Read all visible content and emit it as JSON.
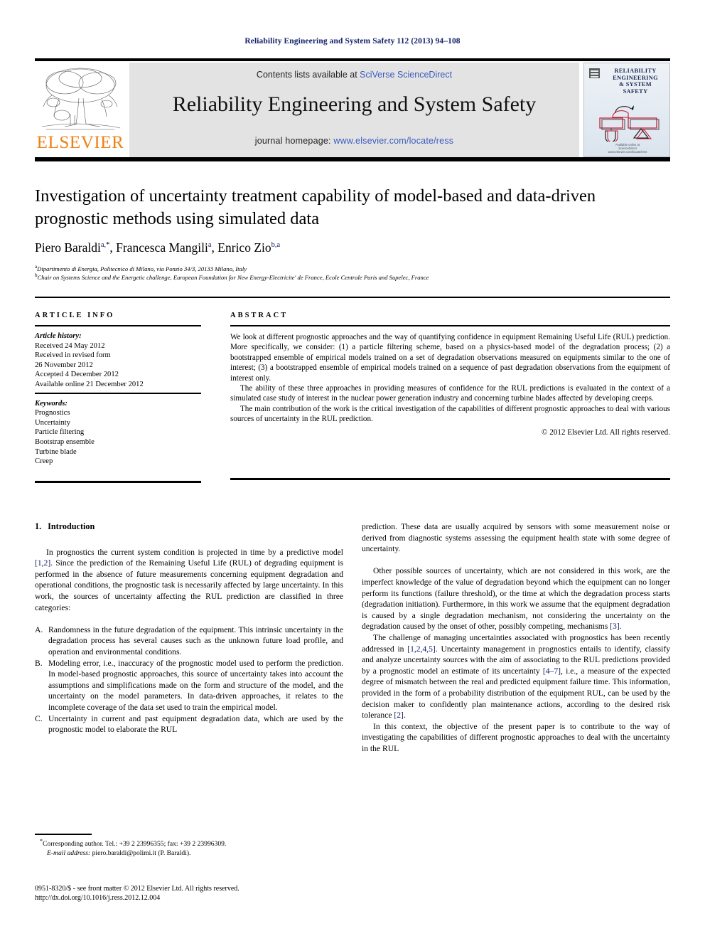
{
  "running_head": "Reliability Engineering and System Safety 112 (2013) 94–108",
  "masthead": {
    "contents_prefix": "Contents lists available at ",
    "contents_link": "SciVerse ScienceDirect",
    "journal_title": "Reliability Engineering and System Safety",
    "homepage_prefix": "journal homepage: ",
    "homepage_link": "www.elsevier.com/locate/ress",
    "publisher_wordmark": "ELSEVIER",
    "publisher_accent": "#f07f13"
  },
  "cover": {
    "title_lines": [
      "RELIABILITY",
      "ENGINEERING",
      "& SYSTEM",
      "SAFETY"
    ],
    "footer_line1": "Available online at",
    "footer_line2": "ScienceDirect",
    "footer_line3": "www.elsevier.com/locate/ress"
  },
  "article": {
    "title": "Investigation of uncertainty treatment capability of model-based and data-driven prognostic methods using simulated data",
    "authors": [
      {
        "name": "Piero Baraldi",
        "sup": "a,",
        "star": "*",
        "sep": ", "
      },
      {
        "name": "Francesca Mangili",
        "sup": "a",
        "star": "",
        "sep": ", "
      },
      {
        "name": "Enrico Zio",
        "sup": "b,a",
        "star": "",
        "sep": ""
      }
    ],
    "affiliations": [
      {
        "mark": "a",
        "text": "Dipartimento di Energia, Politecnico di Milano, via Ponzio 34/3, 20133 Milano, Italy"
      },
      {
        "mark": "b",
        "text": "Chair on Systems Science and the Energetic challenge, European Foundation for New Energy-Electricite' de France, Ecole Centrale Paris and Supelec, France"
      }
    ]
  },
  "article_info": {
    "heading": "ARTICLE INFO",
    "history_label": "Article history:",
    "history": [
      "Received 24 May 2012",
      "Received in revised form",
      "26 November 2012",
      "Accepted 4 December 2012",
      "Available online 21 December 2012"
    ],
    "keywords_label": "Keywords:",
    "keywords": [
      "Prognostics",
      "Uncertainty",
      "Particle filtering",
      "Bootstrap ensemble",
      "Turbine blade",
      "Creep"
    ]
  },
  "abstract": {
    "heading": "ABSTRACT",
    "paragraphs": [
      "We look at different prognostic approaches and the way of quantifying confidence in equipment Remaining Useful Life (RUL) prediction. More specifically, we consider: (1) a particle filtering scheme, based on a physics-based model of the degradation process; (2) a bootstrapped ensemble of empirical models trained on a set of degradation observations measured on equipments similar to the one of interest; (3) a bootstrapped ensemble of empirical models trained on a sequence of past degradation observations from the equipment of interest only.",
      "The ability of these three approaches in providing measures of confidence for the RUL predictions is evaluated in the context of a simulated case study of interest in the nuclear power generation industry and concerning turbine blades affected by developing creeps.",
      "The main contribution of the work is the critical investigation of the capabilities of different prognostic approaches to deal with various sources of uncertainty in the RUL prediction."
    ],
    "copyright": "© 2012 Elsevier Ltd. All rights reserved."
  },
  "body": {
    "section_number": "1.",
    "section_title": "Introduction",
    "left_paragraph_1_a": "In prognostics the current system condition is projected in time by a predictive model ",
    "left_ref_1": "[1,2]",
    "left_paragraph_1_b": ". Since the prediction of the Remaining Useful Life (RUL) of degrading equipment is performed in the absence of future measurements concerning equipment degradation and operational conditions, the prognostic task is necessarily affected by large uncertainty. In this work, the sources of uncertainty affecting the RUL prediction are classified in three categories:",
    "list_items": [
      {
        "marker": "A.",
        "text": "Randomness in the future degradation of the equipment. This intrinsic uncertainty in the degradation process has several causes such as the unknown future load profile, and operation and environmental conditions."
      },
      {
        "marker": "B.",
        "text": "Modeling error, i.e., inaccuracy of the prognostic model used to perform the prediction. In model-based prognostic approaches, this source of uncertainty takes into account the assumptions and simplifications made on the form and structure of the model, and the uncertainty on the model parameters. In data-driven approaches, it relates to the incomplete coverage of the data set used to train the empirical model."
      },
      {
        "marker": "C.",
        "text": "Uncertainty in current and past equipment degradation data, which are used by the prognostic model to elaborate the RUL"
      }
    ],
    "right_paragraph_1": "prediction. These data are usually acquired by sensors with some measurement noise or derived from diagnostic systems assessing the equipment health state with some degree of uncertainty.",
    "right_paragraph_2_a": "Other possible sources of uncertainty, which are not considered in this work, are the imperfect knowledge of the value of degradation beyond which the equipment can no longer perform its functions (failure threshold), or the time at which the degradation process starts (degradation initiation). Furthermore, in this work we assume that the equipment degradation is caused by a single degradation mechanism, not considering the uncertainty on the degradation caused by the onset of other, possibly competing, mechanisms ",
    "right_ref_2": "[3]",
    "right_paragraph_2_b": ".",
    "right_paragraph_3_a": "The challenge of managing uncertainties associated with prognostics has been recently addressed in ",
    "right_ref_3": "[1,2,4,5]",
    "right_paragraph_3_b": ". Uncertainty management in prognostics entails to identify, classify and analyze uncertainty sources with the aim of associating to the RUL predictions provided by a prognostic model an estimate of its uncertainty ",
    "right_ref_4": "[4–7]",
    "right_paragraph_3_c": ", i.e., a measure of the expected degree of mismatch between the real and predicted equipment failure time. This information, provided in the form of a probability distribution of the equipment RUL, can be used by the decision maker to confidently plan maintenance actions, according to the desired risk tolerance ",
    "right_ref_5": "[2]",
    "right_paragraph_3_d": ".",
    "right_paragraph_4": "In this context, the objective of the present paper is to contribute to the way of investigating the capabilities of different prognostic approaches to deal with the uncertainty in the RUL"
  },
  "footnotes": {
    "corresponding": "Corresponding author. Tel.: +39 2 23996355; fax: +39 2 23996309.",
    "email_label": "E-mail address:",
    "email_value": " piero.baraldi@polimi.it (P. Baraldi)."
  },
  "issn_block": {
    "line1": "0951-8320/$ - see front matter © 2012 Elsevier Ltd. All rights reserved.",
    "line2": "http://dx.doi.org/10.1016/j.ress.2012.12.004"
  }
}
